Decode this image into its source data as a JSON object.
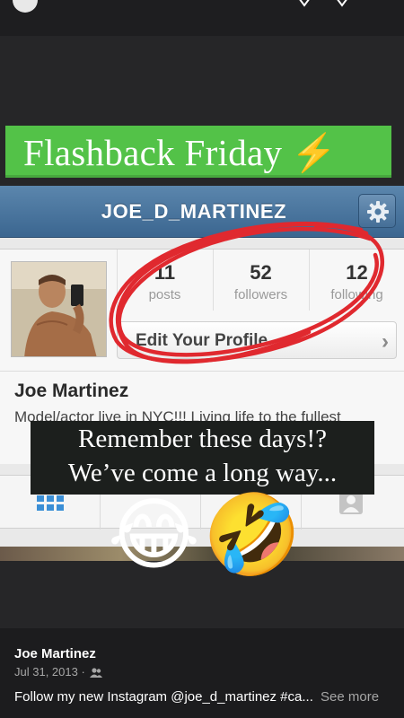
{
  "story": {
    "banner_text": "Flashback Friday",
    "banner_emoji": "⚡",
    "caption_line1": "Remember these days!?",
    "caption_line2": "We’ve come a long way...",
    "emoji_left": "😂",
    "emoji_right": "🤣"
  },
  "instagram_profile": {
    "username": "JOE_D_MARTINEZ",
    "stats": [
      {
        "value": "11",
        "label": "posts"
      },
      {
        "value": "52",
        "label": "followers"
      },
      {
        "value": "12",
        "label": "following"
      }
    ],
    "edit_profile_label": "Edit Your Profile",
    "name": "Joe Martinez",
    "bio": "Model/actor live in NYC!!! Living life to the fullest",
    "icons": [
      "gear-icon",
      "grid-icon",
      "person-tag-icon"
    ]
  },
  "post": {
    "author": "Joe Martinez",
    "date": "Jul 31, 2013",
    "separator": "·",
    "caption": "Follow my new Instagram @joe_d_martinez #ca...",
    "see_more": "See more"
  },
  "colors": {
    "banner_green": "#53c248",
    "header_blue": "#3b6690",
    "scribble_red": "#e0292f",
    "caption_bg": "#1c1f1d",
    "background": "#1c1c1e"
  }
}
